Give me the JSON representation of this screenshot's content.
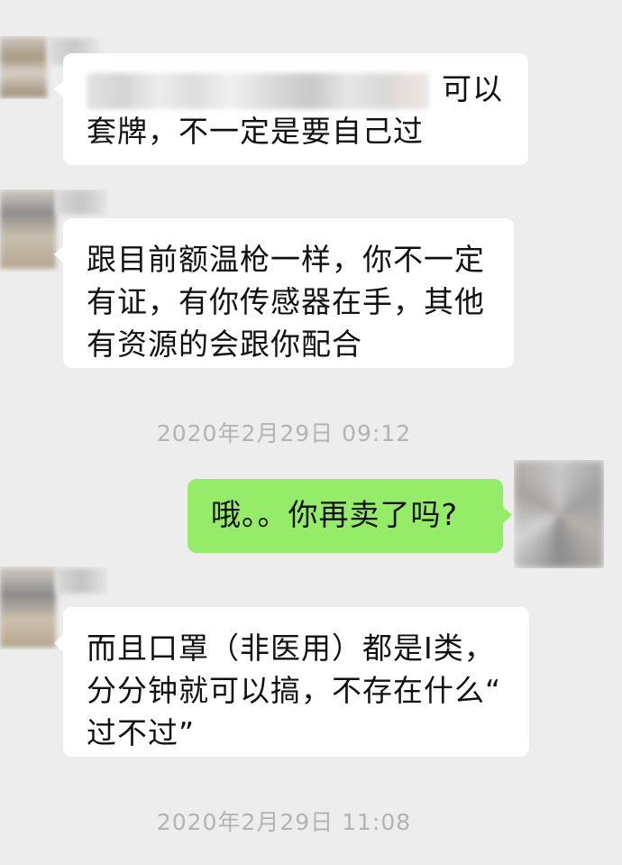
{
  "messages": [
    {
      "side": "left",
      "lines": [
        "可以",
        "套牌，不一定是要自己过"
      ],
      "has_blurred_prefix": true
    },
    {
      "side": "left",
      "lines": [
        "跟目前额温枪一样，你不一定",
        "有证，有你传感器在手，其他",
        "有资源的会跟你配合"
      ]
    },
    {
      "timestamp": "2020年2月29日 09:12"
    },
    {
      "side": "right",
      "lines": [
        "哦。。你再卖了吗?"
      ]
    },
    {
      "side": "left",
      "lines": [
        "而且口罩（非医用）都是I类，",
        "分分钟就可以搞，不存在什么“",
        "过不过”"
      ]
    },
    {
      "timestamp": "2020年2月29日 11:08"
    }
  ],
  "colors": {
    "background": "#ededed",
    "bubble_other": "#ffffff",
    "bubble_self": "#95ec69",
    "timestamp_text": "#b3b3b3",
    "message_text": "#111111"
  },
  "avatars": {
    "left": "blurred-contact-avatar",
    "right": "blurred-user-avatar"
  }
}
